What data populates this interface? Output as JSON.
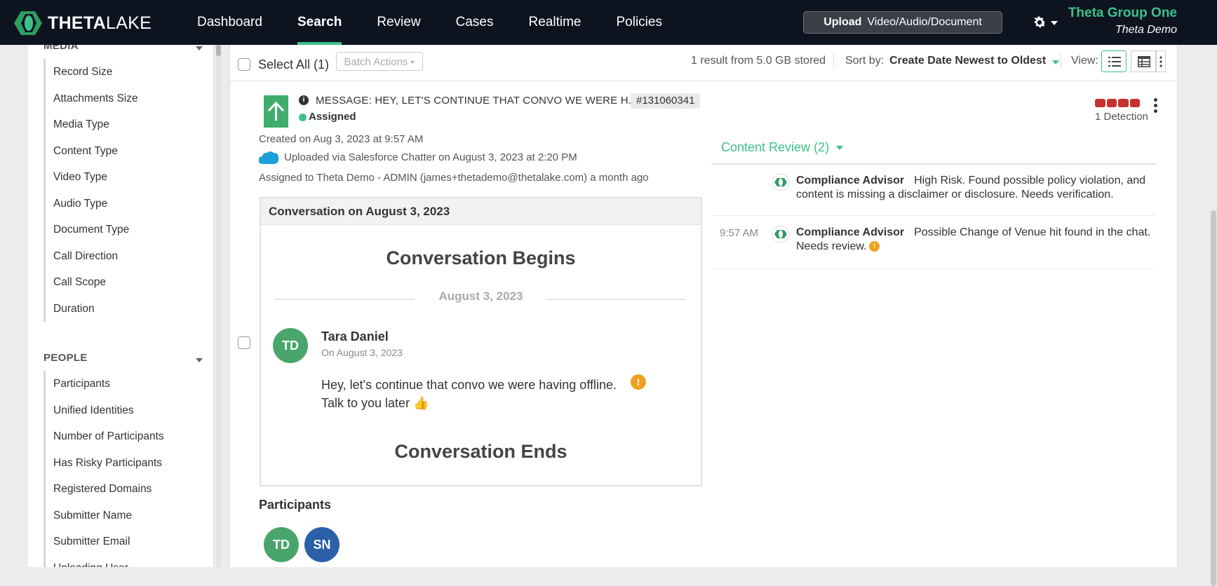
{
  "brand": {
    "logo_bold": "THETA",
    "logo_light": "LAKE"
  },
  "nav": {
    "items": [
      {
        "label": "Dashboard"
      },
      {
        "label": "Search"
      },
      {
        "label": "Review"
      },
      {
        "label": "Cases"
      },
      {
        "label": "Realtime"
      },
      {
        "label": "Policies"
      }
    ],
    "active": "Search",
    "upload_bold": "Upload",
    "upload_rest": "Video/Audio/Document",
    "org_name": "Theta Group One",
    "org_sub": "Theta Demo"
  },
  "sidebar": {
    "media_title": "MEDIA",
    "media_items": [
      "Record Size",
      "Attachments Size",
      "Media Type",
      "Content Type",
      "Video Type",
      "Audio Type",
      "Document Type",
      "Call Direction",
      "Call Scope",
      "Duration"
    ],
    "people_title": "PEOPLE",
    "people_items": [
      "Participants",
      "Unified Identities",
      "Number of Participants",
      "Has Risky Participants",
      "Registered Domains",
      "Submitter Name",
      "Submitter Email",
      "Uploading User"
    ]
  },
  "toolbar": {
    "select_all": "Select All (1)",
    "batch_actions": "Batch Actions",
    "result_text": "1 result from 5.0 GB stored",
    "sort_label": "Sort by:",
    "sort_value": "Create Date Newest to Oldest",
    "view_label": "View:"
  },
  "record": {
    "title": "MESSAGE: HEY, LET'S CONTINUE THAT CONVO WE WERE H...",
    "id": "#131060341",
    "status": "Assigned",
    "created": "Created on Aug 3, 2023 at 9:57 AM",
    "uploaded": "Uploaded via Salesforce Chatter on August 3, 2023 at 2:20 PM",
    "assigned": "Assigned to Theta Demo - ADMIN (james+thetademo@thetalake.com) a month ago",
    "detection_text": "1 Detection"
  },
  "conversation": {
    "header": "Conversation on August 3, 2023",
    "begins": "Conversation Begins",
    "date": "August 3, 2023",
    "message": {
      "initials": "TD",
      "sender": "Tara Daniel",
      "sent_date": "On August 3, 2023",
      "line1": "Hey, let's continue that convo we were having offline.",
      "line2": "Talk to you later 👍"
    },
    "ends": "Conversation Ends"
  },
  "participants": {
    "label": "Participants",
    "list": [
      {
        "initials": "TD",
        "color": "#4aa56c"
      },
      {
        "initials": "SN",
        "color": "#2b5fa8"
      }
    ]
  },
  "content_review": {
    "title": "Content Review (2)",
    "findings": [
      {
        "time": "",
        "source": "Compliance Advisor",
        "text": "High Risk. Found possible policy violation, and content is missing a disclaimer or disclosure. Needs verification."
      },
      {
        "time": "9:57 AM",
        "source": "Compliance Advisor",
        "text": "Possible Change of Venue hit found in the chat. Needs review."
      }
    ]
  },
  "colors": {
    "accent": "#3ec08a",
    "nav_bg": "#0d1420",
    "risk": "#c82f2f",
    "warning": "#f0a020"
  }
}
